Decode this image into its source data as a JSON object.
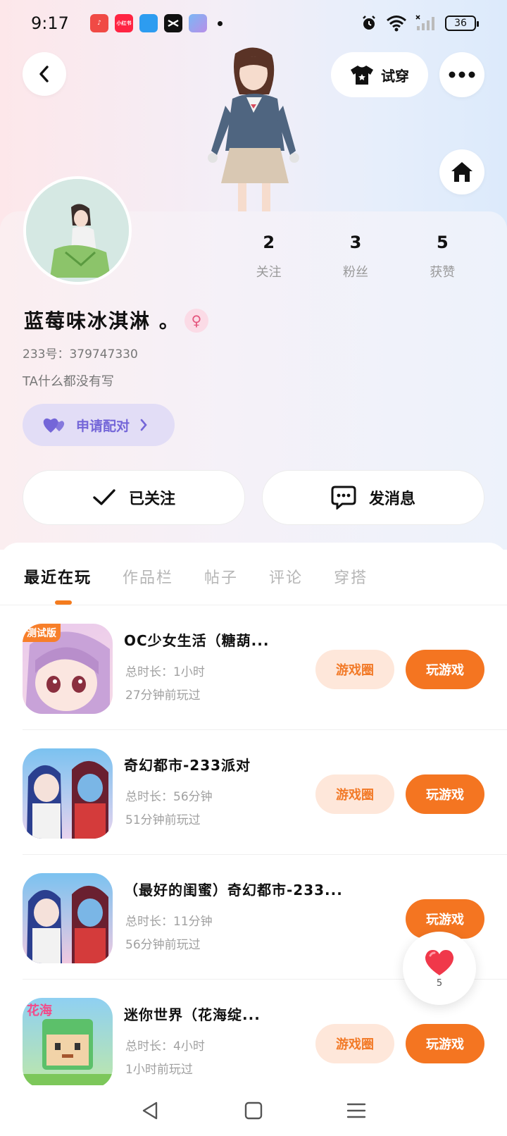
{
  "status_bar": {
    "time": "9:17",
    "app_icons": [
      {
        "name": "music-app-icon",
        "color": "#f04a45",
        "label": "♪"
      },
      {
        "name": "xiaohongshu-app-icon",
        "color": "#ff2442",
        "label": "小红书"
      },
      {
        "name": "feather-app-icon",
        "color": "#2d9cf0",
        "label": ""
      },
      {
        "name": "capcut-app-icon",
        "color": "#111111",
        "label": ""
      },
      {
        "name": "game-app-icon",
        "color": "#6a8be8",
        "label": ""
      }
    ],
    "battery": "36"
  },
  "header": {
    "try_on_label": "试穿"
  },
  "profile": {
    "stats": [
      {
        "value": "2",
        "label": "关注"
      },
      {
        "value": "3",
        "label": "粉丝"
      },
      {
        "value": "5",
        "label": "获赞"
      }
    ],
    "nickname": "蓝莓味冰淇淋 。",
    "uid": "233号：379747330",
    "bio": "TA什么都没有写",
    "pair_label": "申请配对",
    "follow_label": "已关注",
    "message_label": "发消息"
  },
  "tabs": [
    "最近在玩",
    "作品栏",
    "帖子",
    "评论",
    "穿搭"
  ],
  "games": [
    {
      "title": "OC少女生活（糖葫...",
      "duration": "总时长：1小时",
      "last_played": "27分钟前玩过",
      "badge": "测试版",
      "circle_label": "游戏圈",
      "play_label": "玩游戏"
    },
    {
      "title": "奇幻都市-233派对",
      "duration": "总时长：56分钟",
      "last_played": "51分钟前玩过",
      "circle_label": "游戏圈",
      "play_label": "玩游戏"
    },
    {
      "title": "（最好的闺蜜）奇幻都市-233...",
      "duration": "总时长：11分钟",
      "last_played": "56分钟前玩过",
      "play_label": "玩游戏"
    },
    {
      "title": "迷你世界（花海绽...",
      "duration": "总时长：4小时",
      "last_played": "1小时前玩过",
      "circle_label": "游戏圈",
      "play_label": "玩游戏"
    }
  ],
  "like_fab": {
    "count": "5"
  },
  "colors": {
    "accent": "#f47521",
    "accent_light": "#fee7da",
    "pair": "#7466d8"
  }
}
